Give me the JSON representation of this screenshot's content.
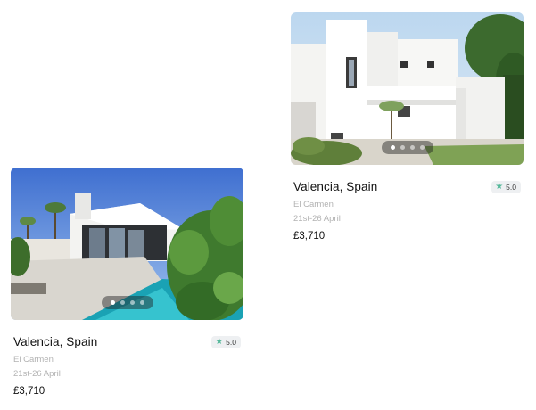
{
  "listings": [
    {
      "title": "Valencia, Spain",
      "rating": "5.0",
      "neighborhood": "El Carmen",
      "dates": "21st-26 April",
      "price": "£3,710",
      "image_icon": "house-photo",
      "pager_count": 4,
      "pager_active": 0
    },
    {
      "title": "Valencia, Spain",
      "rating": "5.0",
      "neighborhood": "El Carmen",
      "dates": "21st-26 April",
      "price": "£3,710",
      "image_icon": "house-photo",
      "pager_count": 4,
      "pager_active": 0
    }
  ],
  "colors": {
    "star": "#55b89a",
    "muted_text": "#b3b3b3",
    "badge_bg": "#eef0f2"
  }
}
